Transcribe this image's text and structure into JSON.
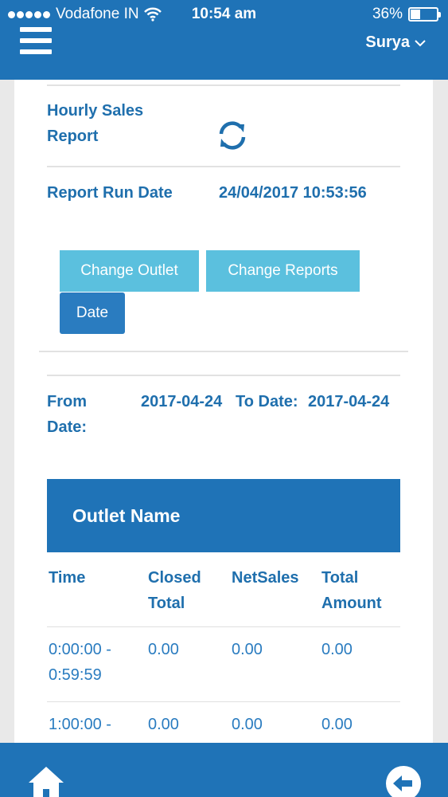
{
  "status_bar": {
    "carrier": "Vodafone IN",
    "time": "10:54 am",
    "battery_percent": "36%",
    "battery_level": 0.36
  },
  "header": {
    "user_name": "Surya",
    "menu_icon": "hamburger-menu-icon",
    "user_chevron_icon": "chevron-down-icon"
  },
  "report": {
    "title": "Hourly Sales Report",
    "refresh_icon": "refresh-icon",
    "run_date_label": "Report Run Date",
    "run_date_value": "24/04/2017 10:53:56"
  },
  "buttons": {
    "change_outlet": "Change Outlet",
    "change_reports": "Change Reports",
    "date": "Date"
  },
  "date_range": {
    "from_label": "From Date:",
    "from_value": "2017-04-24",
    "to_label": "To Date:",
    "to_value": "2017-04-24"
  },
  "table": {
    "group_header": "Outlet Name",
    "columns": [
      "Time",
      "Closed Total",
      "NetSales",
      "Total Amount"
    ],
    "rows": [
      [
        "0:00:00 - 0:59:59",
        "0.00",
        "0.00",
        "0.00"
      ],
      [
        "1:00:00 -",
        "0.00",
        "0.00",
        "0.00"
      ]
    ]
  },
  "footer": {
    "home_icon": "home-icon",
    "back_icon": "back-arrow-icon"
  },
  "colors": {
    "primary": "#1f73b7",
    "button_light": "#5bc0de",
    "button_dark": "#2a7cc0",
    "text_blue": "#1f6fad"
  }
}
